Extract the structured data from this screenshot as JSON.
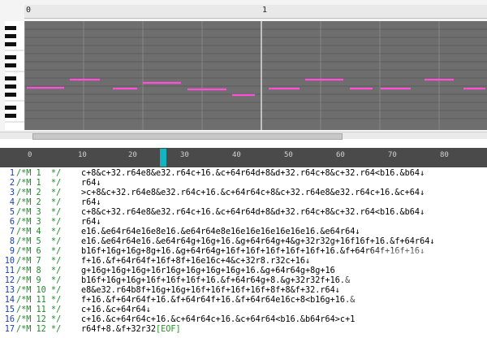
{
  "roll": {
    "ruler_left": "0",
    "ruler_mid": "1",
    "notes_color": "#ff4fd8",
    "grid_color": "#6e6e6e"
  },
  "editor_ruler": [
    "0",
    "10",
    "20",
    "30",
    "40",
    "50",
    "60",
    "70",
    "80"
  ],
  "lines": [
    {
      "n": "1",
      "c": "/*M 1  */",
      "t": "c+8&c+32.r64e8&e32.r64c+16.&c+64r64d+8&d+32.r64c+8&c+32.r64<b16.&b64↓"
    },
    {
      "n": "2",
      "c": "/*M 1  */",
      "t": "r64↓"
    },
    {
      "n": "3",
      "c": "/*M 2  */",
      "t": ">c+8&c+32.r64e8&e32.r64c+16.&c+64r64c+8&c+32.r64e8&e32.r64c+16.&c+64↓"
    },
    {
      "n": "4",
      "c": "/*M 2  */",
      "t": "r64↓"
    },
    {
      "n": "5",
      "c": "/*M 3  */",
      "t": "c+8&c+32.r64e8&e32.r64c+16.&c+64r64d+8&d+32.r64c+8&c+32.r64<b16.&b64↓"
    },
    {
      "n": "6",
      "c": "/*M 3  */",
      "t": "r64↓"
    },
    {
      "n": "7",
      "c": "/*M 4  */",
      "t": "e16.&e64r64e16e8e16.&e64r64e8e16e16e16e16e16e16.&e64r64↓"
    },
    {
      "n": "8",
      "c": "/*M 5  */",
      "t": "e16.&e64r64e16.&e64r64g+16g+16.&g+64r64g+4&g+32r32g+16f16f+16.&f+64r64↓"
    },
    {
      "n": "9",
      "c": "/*M 6  */",
      "t": "b16f+16g+16g+8g+16.&g+64r64g+16f+16f+16f+16f+16f+16.&f+64r64f+16f+16↓"
    },
    {
      "n": "10",
      "c": "/*M 7  */",
      "t": "f+16.&f+64r64f+16f+8f+16e16c+4&c+32r8.r32c+16↓"
    },
    {
      "n": "11",
      "c": "/*M 8  */",
      "t": "g+16g+16g+16g+16r16g+16g+16g+16g+16.&g+64r64g+8g+16"
    },
    {
      "n": "12",
      "c": "/*M 9  */",
      "t": "b16f+16g+16g+16f+16f+16f+16.&f+64r64g+8.&g+32r32f+16.&"
    },
    {
      "n": "13",
      "c": "/*M 10 */",
      "t": "e8&e32.r64b8f+16g+16g+16f+16f+16f+16f+8f+8&f+32.r64↓"
    },
    {
      "n": "14",
      "c": "/*M 11 */",
      "t": "f+16.&f+64r64f+16.&f+64r64f+16.&f+64r64e16c+8<b16g+16.&"
    },
    {
      "n": "15",
      "c": "/*M 11 */",
      "t": "c+16.&c+64r64↓"
    },
    {
      "n": "16",
      "c": "/*M 12 */",
      "t": "c+16.&c+64r64c+16.&c+64r64c+16.&c+64r64<b16.&b64r64>c+1"
    },
    {
      "n": "17",
      "c": "/*M 12 */",
      "t": "r64f+8.&f+32r32",
      "eof": "[EOF]"
    }
  ]
}
